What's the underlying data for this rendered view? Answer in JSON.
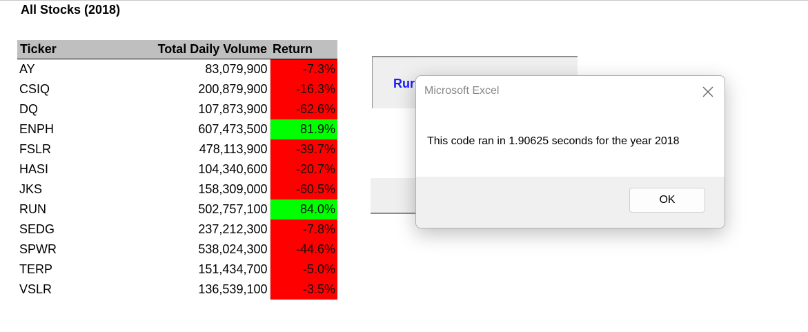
{
  "sheet": {
    "title": "All Stocks (2018)",
    "headers": {
      "ticker": "Ticker",
      "volume": "Total Daily Volume",
      "return": "Return"
    },
    "rows": [
      {
        "ticker": "AY",
        "volume": "83,079,900",
        "return": "-7.3%",
        "positive": false
      },
      {
        "ticker": "CSIQ",
        "volume": "200,879,900",
        "return": "-16.3%",
        "positive": false
      },
      {
        "ticker": "DQ",
        "volume": "107,873,900",
        "return": "-62.6%",
        "positive": false
      },
      {
        "ticker": "ENPH",
        "volume": "607,473,500",
        "return": "81.9%",
        "positive": true
      },
      {
        "ticker": "FSLR",
        "volume": "478,113,900",
        "return": "-39.7%",
        "positive": false
      },
      {
        "ticker": "HASI",
        "volume": "104,340,600",
        "return": "-20.7%",
        "positive": false
      },
      {
        "ticker": "JKS",
        "volume": "158,309,000",
        "return": "-60.5%",
        "positive": false
      },
      {
        "ticker": "RUN",
        "volume": "502,757,100",
        "return": "84.0%",
        "positive": true
      },
      {
        "ticker": "SEDG",
        "volume": "237,212,300",
        "return": "-7.8%",
        "positive": false
      },
      {
        "ticker": "SPWR",
        "volume": "538,024,300",
        "return": "-44.6%",
        "positive": false
      },
      {
        "ticker": "TERP",
        "volume": "151,434,700",
        "return": "-5.0%",
        "positive": false
      },
      {
        "ticker": "VSLR",
        "volume": "136,539,100",
        "return": "-3.5%",
        "positive": false
      }
    ],
    "colors": {
      "negative": "#ff0000",
      "positive": "#00ff00",
      "header_bg": "#bfbfbf"
    }
  },
  "run_button": {
    "visible_label": "Rur"
  },
  "dialog": {
    "title": "Microsoft Excel",
    "message": "This code ran in 1.90625 seconds for the year 2018",
    "ok_label": "OK",
    "close_icon": "close-icon"
  }
}
